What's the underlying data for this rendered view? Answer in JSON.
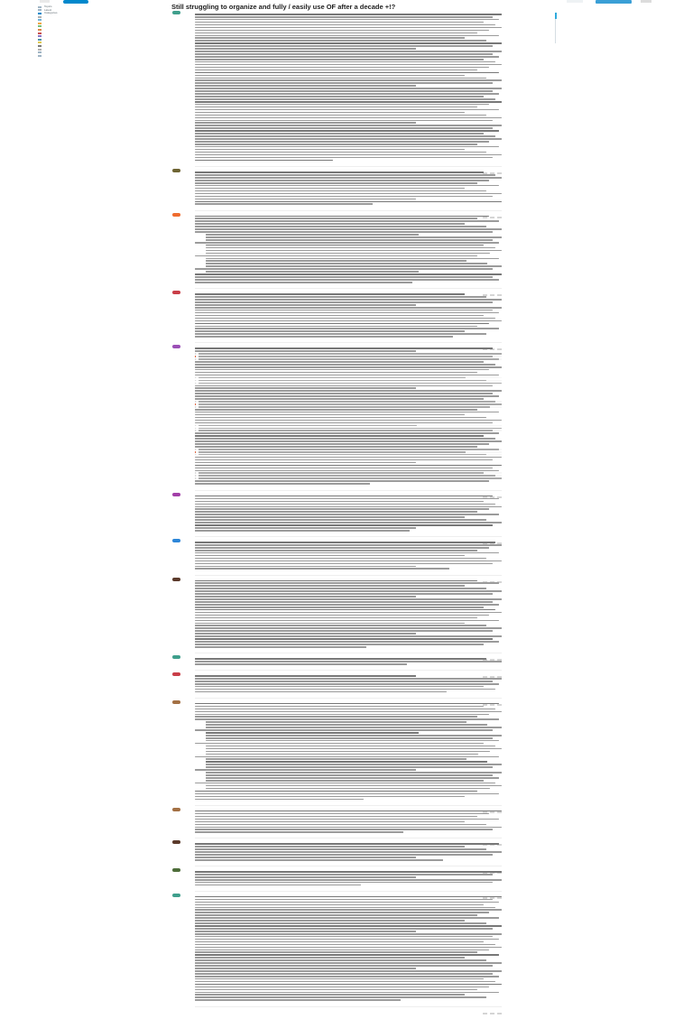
{
  "header": {
    "title": "Still struggling to organize and fully / easily use OF after a decade +!?"
  },
  "colors": {
    "accent": "#0088cc",
    "link_blue": "#3a9fd6",
    "quote_bg": "#f6f6f6",
    "heading": "#1c1c1c"
  },
  "sidebar": {
    "items": [
      {
        "label": "Topics",
        "color": "#9fb4c4",
        "icon": "topics-icon"
      },
      {
        "label": "Latest",
        "color": "#9fb4c4",
        "icon": "latest-icon"
      },
      {
        "label": "Categories",
        "color": "#0088cc",
        "icon": "categories-icon"
      },
      {
        "label": "",
        "color": "#b0b0b0",
        "icon": "category-icon"
      },
      {
        "label": "",
        "color": "#6fb2d9",
        "icon": "category-icon"
      },
      {
        "label": "",
        "color": "#f3a742",
        "icon": "category-icon"
      },
      {
        "label": "",
        "color": "#77c07a",
        "icon": "category-icon"
      },
      {
        "label": "",
        "color": "#d98b4a",
        "icon": "category-icon"
      },
      {
        "label": "",
        "color": "#c94e4e",
        "icon": "category-icon"
      },
      {
        "label": "",
        "color": "#8a74c5",
        "icon": "category-icon"
      },
      {
        "label": "",
        "color": "#4f93a9",
        "icon": "category-icon"
      },
      {
        "label": "",
        "color": "#e1c84d",
        "icon": "category-icon"
      },
      {
        "label": "",
        "color": "#7a7a7a",
        "icon": "category-icon"
      },
      {
        "label": "",
        "color": "#b0b0b0",
        "icon": "category-icon"
      },
      {
        "label": "",
        "color": "#9fb4c4",
        "icon": "tags-icon"
      },
      {
        "label": "",
        "color": "#9fb4c4",
        "icon": "tag-icon"
      }
    ]
  },
  "posts": [
    {
      "avatar_color": "#3f9f8c",
      "lines": 56,
      "variant": "plain"
    },
    {
      "avatar_color": "#6e6433",
      "lines": 13,
      "variant": "plain"
    },
    {
      "avatar_color": "#ef6c2f",
      "lines": 26,
      "variant": "list"
    },
    {
      "avatar_color": "#c93e48",
      "lines": 17,
      "variant": "plain"
    },
    {
      "avatar_color": "#9b4fb6",
      "lines": 52,
      "variant": "quotes"
    },
    {
      "avatar_color": "#a23fa8",
      "lines": 14,
      "variant": "plain"
    },
    {
      "avatar_color": "#2d86d8",
      "lines": 11,
      "variant": "plain"
    },
    {
      "avatar_color": "#5b3a2b",
      "lines": 26,
      "variant": "plain"
    },
    {
      "avatar_color": "#3f9f8c",
      "lines": 3,
      "variant": "plain"
    },
    {
      "avatar_color": "#c93e48",
      "lines": 7,
      "variant": "plain"
    },
    {
      "avatar_color": "#a37044",
      "lines": 37,
      "variant": "list"
    },
    {
      "avatar_color": "#a37044",
      "lines": 9,
      "variant": "plain"
    },
    {
      "avatar_color": "#5b3a2b",
      "lines": 7,
      "variant": "plain"
    },
    {
      "avatar_color": "#4e6d3a",
      "lines": 6,
      "variant": "plain"
    },
    {
      "avatar_color": "#3f9f8c",
      "lines": 40,
      "variant": "plain"
    }
  ]
}
